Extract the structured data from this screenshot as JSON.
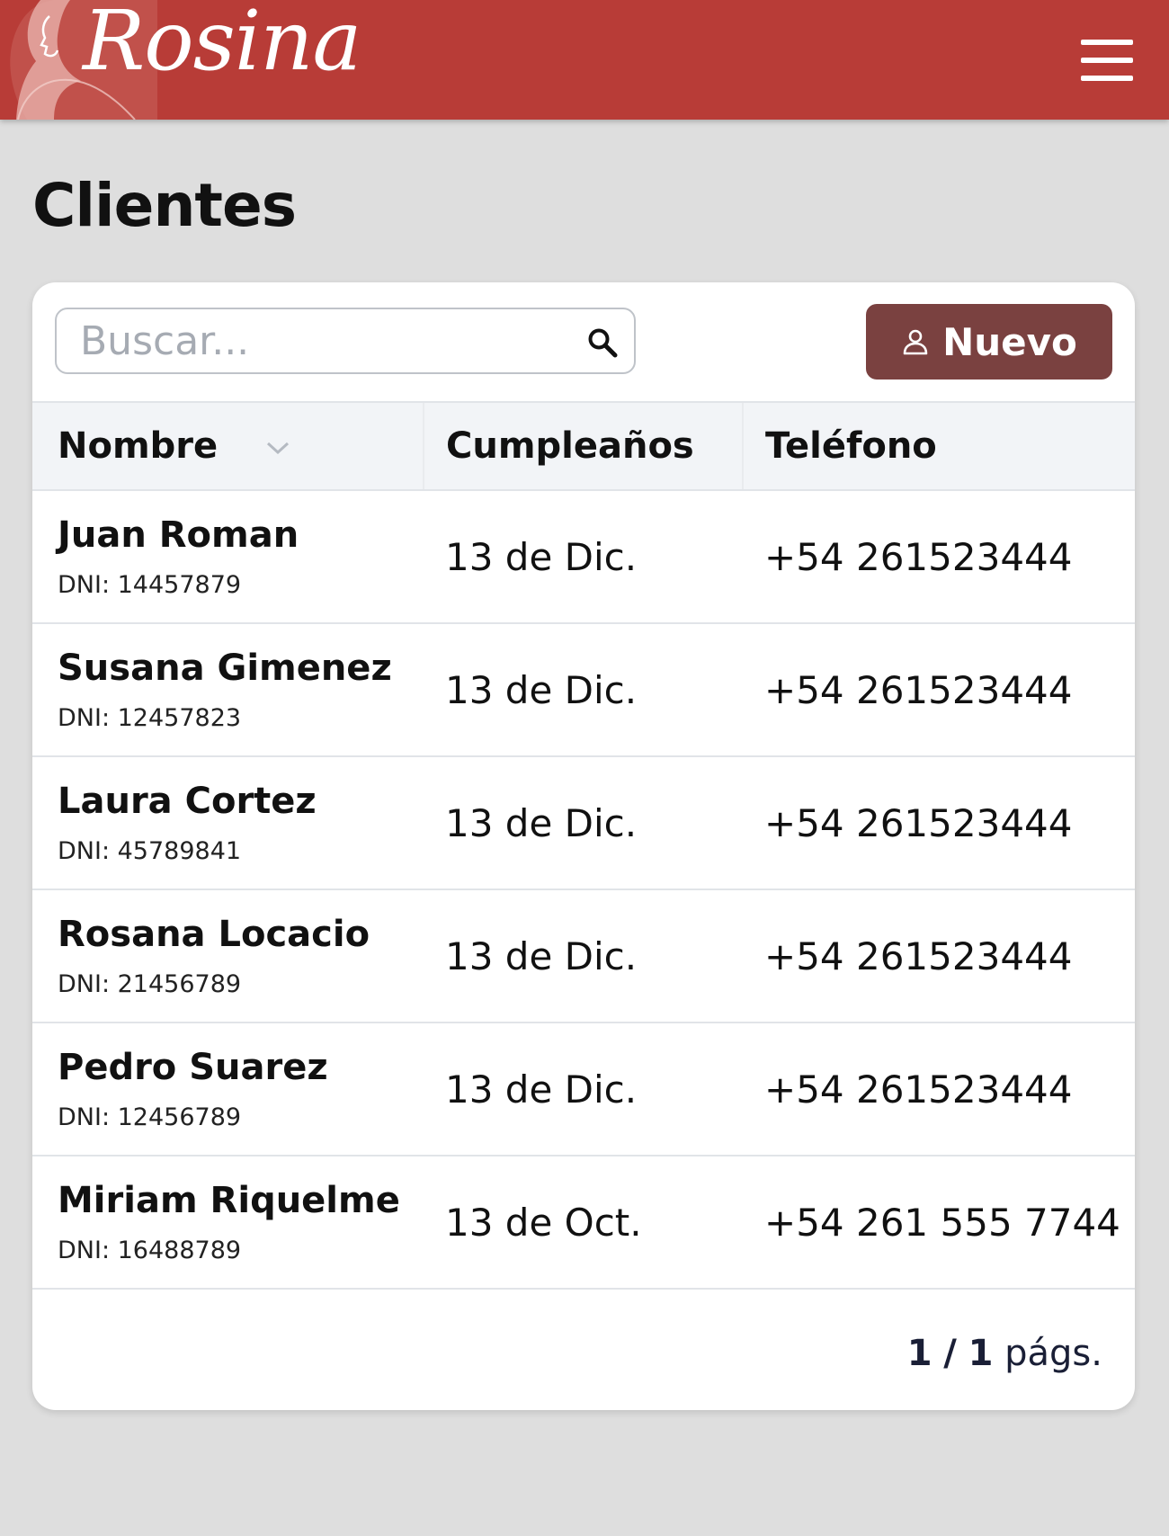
{
  "header": {
    "brand": "Rosina",
    "menu_icon": "hamburger-menu-icon",
    "color": "#b83c37"
  },
  "page": {
    "title": "Clientes"
  },
  "toolbar": {
    "search_placeholder": "Buscar...",
    "search_value": "",
    "new_label": "Nuevo",
    "new_button_color": "#7a4140"
  },
  "table": {
    "headers": {
      "name": "Nombre",
      "birthday": "Cumpleaños",
      "phone": "Teléfono"
    },
    "rows": [
      {
        "name": "Juan Roman",
        "dni": "DNI: 14457879",
        "birthday": "13 de Dic.",
        "phone": "+54 261523444"
      },
      {
        "name": "Susana Gimenez",
        "dni": "DNI: 12457823",
        "birthday": "13 de Dic.",
        "phone": "+54 261523444"
      },
      {
        "name": "Laura Cortez",
        "dni": "DNI: 45789841",
        "birthday": "13 de Dic.",
        "phone": "+54 261523444"
      },
      {
        "name": "Rosana Locacio",
        "dni": "DNI: 21456789",
        "birthday": "13 de Dic.",
        "phone": "+54 261523444"
      },
      {
        "name": "Pedro Suarez",
        "dni": "DNI: 12456789",
        "birthday": "13 de Dic.",
        "phone": "+54 261523444"
      },
      {
        "name": "Miriam Riquelme",
        "dni": "DNI: 16488789",
        "birthday": "13 de Oct.",
        "phone": "+54 261 555 7744"
      }
    ]
  },
  "pagination": {
    "current": "1",
    "total": "1",
    "suffix": "págs."
  }
}
